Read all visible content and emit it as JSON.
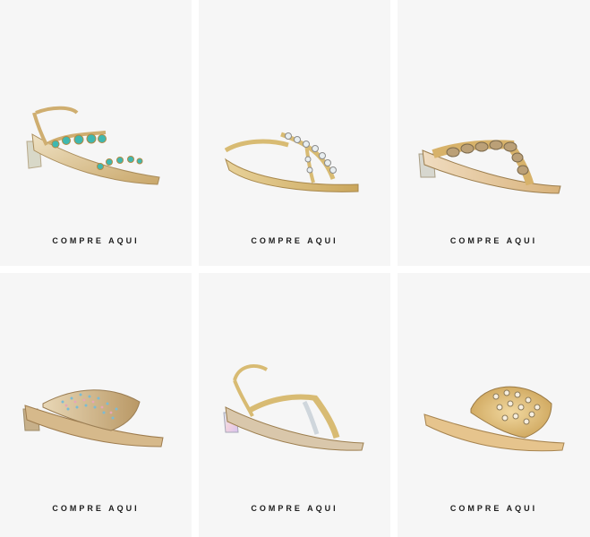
{
  "products": [
    {
      "cta": "COMPRE AQUI",
      "image": "turquoise-stone-block-heel-sandal"
    },
    {
      "cta": "COMPRE AQUI",
      "image": "gold-crystal-t-strap-flat-sandal"
    },
    {
      "cta": "COMPRE AQUI",
      "image": "gold-chain-thong-sandal"
    },
    {
      "cta": "COMPRE AQUI",
      "image": "crystal-studded-slide"
    },
    {
      "cta": "COMPRE AQUI",
      "image": "iridescent-chain-strap-sandal"
    },
    {
      "cta": "COMPRE AQUI",
      "image": "gold-studded-mule"
    }
  ],
  "colors": {
    "card_bg": "#f6f6f6",
    "cta_text": "#1d1d1d",
    "gold": "#d6b25e",
    "turquoise": "#3fb8b0"
  }
}
